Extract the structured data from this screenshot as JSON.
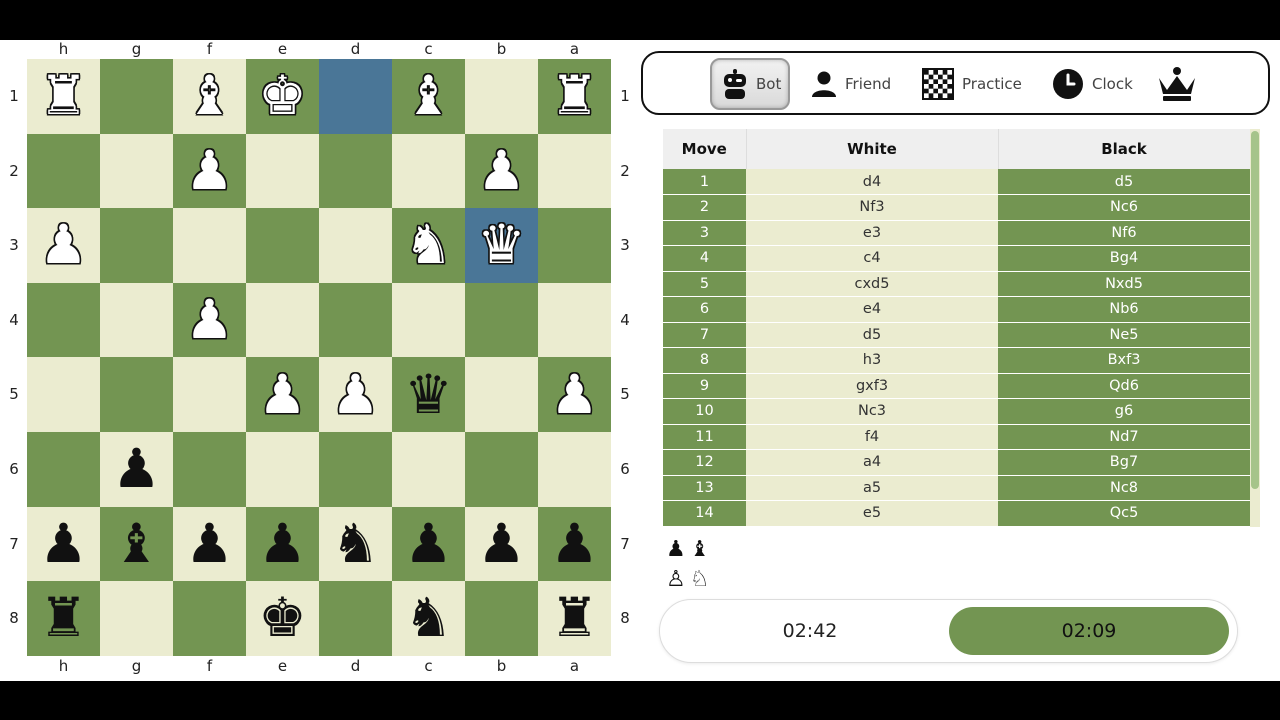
{
  "board": {
    "files": [
      "h",
      "g",
      "f",
      "e",
      "d",
      "c",
      "b",
      "a"
    ],
    "ranks": [
      "1",
      "2",
      "3",
      "4",
      "5",
      "6",
      "7",
      "8"
    ],
    "highlighted_squares": [
      "d1",
      "b3"
    ],
    "pieces": [
      {
        "square": "h1",
        "color": "white",
        "type": "rook",
        "glyph": "♜"
      },
      {
        "square": "f1",
        "color": "white",
        "type": "bishop",
        "glyph": "♝"
      },
      {
        "square": "e1",
        "color": "white",
        "type": "king",
        "glyph": "♚"
      },
      {
        "square": "c1",
        "color": "white",
        "type": "bishop",
        "glyph": "♝"
      },
      {
        "square": "a1",
        "color": "white",
        "type": "rook",
        "glyph": "♜"
      },
      {
        "square": "f2",
        "color": "white",
        "type": "pawn",
        "glyph": "♟"
      },
      {
        "square": "b2",
        "color": "white",
        "type": "pawn",
        "glyph": "♟"
      },
      {
        "square": "h3",
        "color": "white",
        "type": "pawn",
        "glyph": "♟"
      },
      {
        "square": "c3",
        "color": "white",
        "type": "knight",
        "glyph": "♞"
      },
      {
        "square": "b3",
        "color": "white",
        "type": "queen",
        "glyph": "♛"
      },
      {
        "square": "f4",
        "color": "white",
        "type": "pawn",
        "glyph": "♟"
      },
      {
        "square": "e5",
        "color": "white",
        "type": "pawn",
        "glyph": "♟"
      },
      {
        "square": "d5",
        "color": "white",
        "type": "pawn",
        "glyph": "♟"
      },
      {
        "square": "c5",
        "color": "black",
        "type": "queen",
        "glyph": "♛"
      },
      {
        "square": "a5",
        "color": "white",
        "type": "pawn",
        "glyph": "♟"
      },
      {
        "square": "g6",
        "color": "black",
        "type": "pawn",
        "glyph": "♟"
      },
      {
        "square": "h7",
        "color": "black",
        "type": "pawn",
        "glyph": "♟"
      },
      {
        "square": "g7",
        "color": "black",
        "type": "bishop",
        "glyph": "♝"
      },
      {
        "square": "f7",
        "color": "black",
        "type": "pawn",
        "glyph": "♟"
      },
      {
        "square": "e7",
        "color": "black",
        "type": "pawn",
        "glyph": "♟"
      },
      {
        "square": "d7",
        "color": "black",
        "type": "knight",
        "glyph": "♞"
      },
      {
        "square": "c7",
        "color": "black",
        "type": "pawn",
        "glyph": "♟"
      },
      {
        "square": "b7",
        "color": "black",
        "type": "pawn",
        "glyph": "♟"
      },
      {
        "square": "a7",
        "color": "black",
        "type": "pawn",
        "glyph": "♟"
      },
      {
        "square": "h8",
        "color": "black",
        "type": "rook",
        "glyph": "♜"
      },
      {
        "square": "e8",
        "color": "black",
        "type": "king",
        "glyph": "♚"
      },
      {
        "square": "c8",
        "color": "black",
        "type": "knight",
        "glyph": "♞"
      },
      {
        "square": "a8",
        "color": "black",
        "type": "rook",
        "glyph": "♜"
      }
    ]
  },
  "modes": {
    "bot": {
      "label": "Bot",
      "icon": "robot-icon",
      "active": true
    },
    "friend": {
      "label": "Friend",
      "icon": "person-icon"
    },
    "practice": {
      "label": "Practice",
      "icon": "checkerboard-icon"
    },
    "clock": {
      "label": "Clock",
      "icon": "clock-icon"
    },
    "logo": {
      "icon": "crown-icon"
    }
  },
  "moves": {
    "headers": {
      "move": "Move",
      "white": "White",
      "black": "Black"
    },
    "rows": [
      {
        "n": "1",
        "white": "d4",
        "black": "d5"
      },
      {
        "n": "2",
        "white": "Nf3",
        "black": "Nc6"
      },
      {
        "n": "3",
        "white": "e3",
        "black": "Nf6"
      },
      {
        "n": "4",
        "white": "c4",
        "black": "Bg4"
      },
      {
        "n": "5",
        "white": "cxd5",
        "black": "Nxd5"
      },
      {
        "n": "6",
        "white": "e4",
        "black": "Nb6"
      },
      {
        "n": "7",
        "white": "d5",
        "black": "Ne5"
      },
      {
        "n": "8",
        "white": "h3",
        "black": "Bxf3"
      },
      {
        "n": "9",
        "white": "gxf3",
        "black": "Qd6"
      },
      {
        "n": "10",
        "white": "Nc3",
        "black": "g6"
      },
      {
        "n": "11",
        "white": "f4",
        "black": "Nd7"
      },
      {
        "n": "12",
        "white": "a4",
        "black": "Bg7"
      },
      {
        "n": "13",
        "white": "a5",
        "black": "Nc8"
      },
      {
        "n": "14",
        "white": "e5",
        "black": "Qc5"
      }
    ]
  },
  "captured": {
    "by_white": [
      "♟",
      "♝"
    ],
    "by_black": [
      "♙",
      "♘"
    ]
  },
  "clocks": {
    "white": "02:42",
    "black": "02:09",
    "active": "black",
    "active_color": "#739552"
  },
  "colors": {
    "light_square": "#ebecd0",
    "dark_square": "#739552",
    "highlight": "#4a7697"
  }
}
